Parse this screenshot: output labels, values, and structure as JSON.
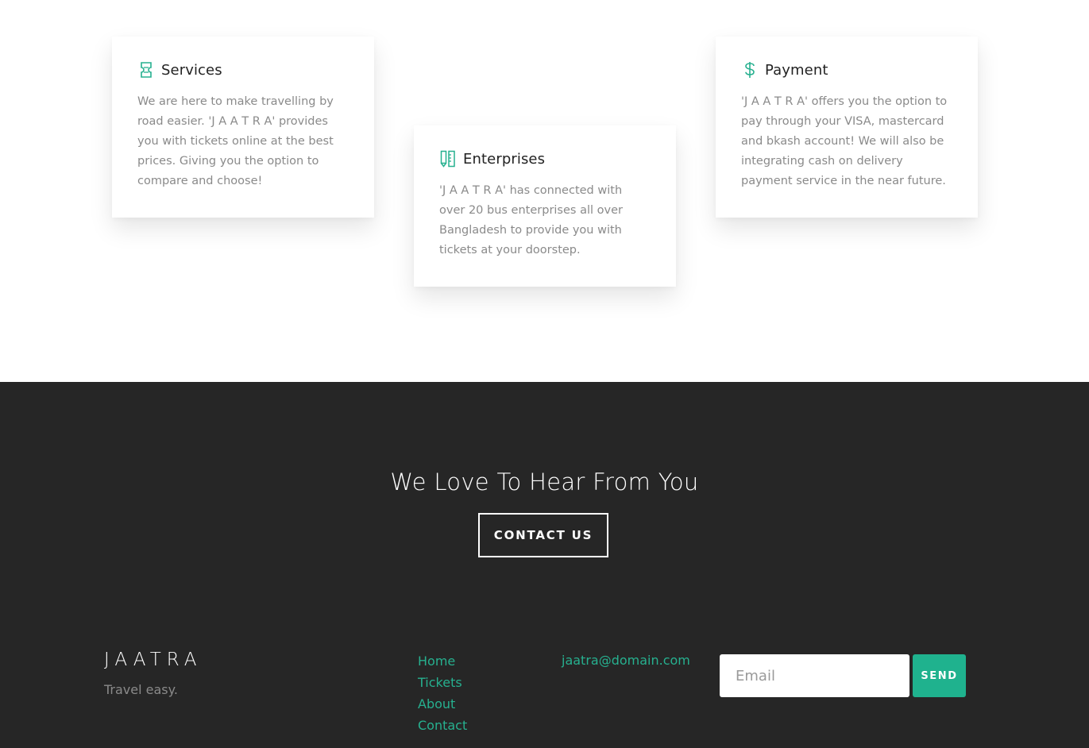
{
  "colors": {
    "accent": "#26b08f",
    "dark_bg": "#262626",
    "text_muted": "#8a8a8a"
  },
  "features": [
    {
      "icon": "ticket-icon",
      "title": "Services",
      "text": "We are here to make travelling by road easier. 'J A A T R A' provides you with tickets online at the best prices. Giving you the option to compare and choose!"
    },
    {
      "icon": "enterprise-tools-icon",
      "title": "Enterprises",
      "text": "'J A A T R A' has connected with over 20 bus enterprises all over Bangladesh to provide you with tickets at your doorstep."
    },
    {
      "icon": "dollar-icon",
      "title": "Payment",
      "text": "'J A A T R A' offers you the option to pay through your VISA, mastercard and bkash account! We will also be integrating cash on delivery payment service in the near future."
    }
  ],
  "cta": {
    "title": "We Love To Hear From You",
    "button_label": "CONTACT US"
  },
  "footer": {
    "brand": "JAATRA",
    "tagline": "Travel easy.",
    "nav": [
      "Home",
      "Tickets",
      "About",
      "Contact"
    ],
    "email": "jaatra@domain.com",
    "newsletter": {
      "placeholder": "Email",
      "button_label": "SEND"
    }
  }
}
